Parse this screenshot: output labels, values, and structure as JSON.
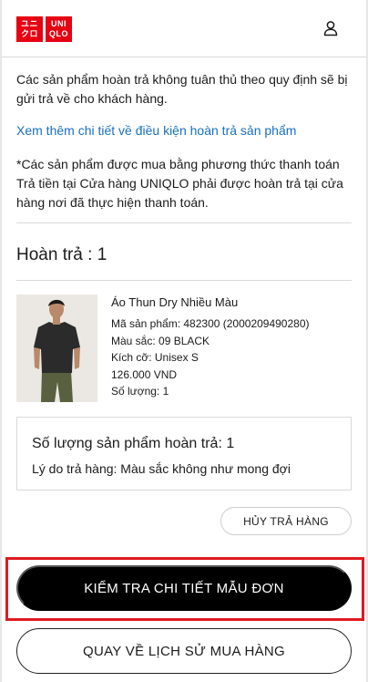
{
  "header": {
    "logo_lines": [
      "UNI",
      "QLO"
    ],
    "logo_jp_lines": [
      "ユニ",
      "クロ"
    ],
    "brand_color": "#e60012",
    "user_icon": "user-icon"
  },
  "notices": {
    "non_compliant": "Các sản phẩm hoàn trả không tuân thủ theo quy định sẽ bị gửi trả về cho khách hàng.",
    "details_link": "Xem thêm chi tiết về điều kiện hoàn trả sản phẩm",
    "payment_note": "*Các sản phẩm được mua bằng phương thức thanh toán Trả tiền tại Cửa hàng UNIQLO phải được hoàn trả tại cửa hàng nơi đã thực hiện thanh toán."
  },
  "return_count": "Hoàn trả : 1",
  "product": {
    "name": "Áo Thun Dry Nhiều Màu",
    "code": "Mã sản phẩm: 482300 (2000209490280)",
    "color": "Màu sắc: 09 BLACK",
    "size": "Kích cỡ: Unisex S",
    "price": "126.000 VND",
    "quantity": "Số lượng: 1"
  },
  "summary": {
    "qty": "Số lượng sản phẩm hoàn trả: 1",
    "reason": "Lý do trả hàng: Màu sắc không như mong đợi"
  },
  "buttons": {
    "cancel": "HỦY TRẢ HÀNG",
    "check_details": "KIỂM TRA CHI TIẾT MẪU ĐƠN",
    "back_history": "QUAY VỀ LỊCH SỬ MUA HÀNG"
  },
  "colors": {
    "link": "#1a6fbe",
    "highlight": "#e0191f",
    "primary_button": "#000000"
  }
}
